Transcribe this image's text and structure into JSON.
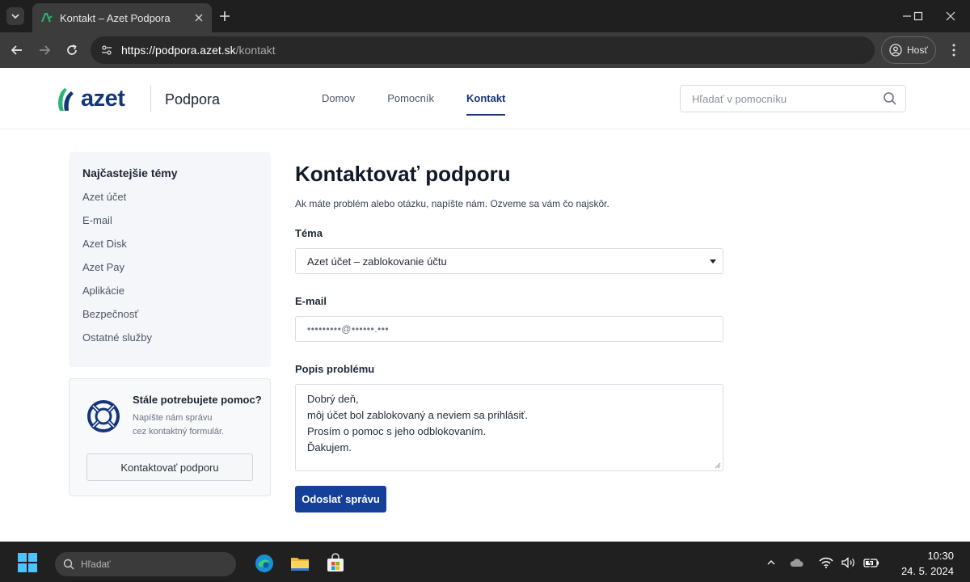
{
  "browser": {
    "tab_title": "Kontakt – Azet Podpora",
    "url_host": "https://podpora.azet.sk",
    "url_path": "/kontakt",
    "profile_label": "Hosť"
  },
  "site": {
    "logo_text": "azet",
    "site_name": "Podpora",
    "nav": [
      {
        "label": "Domov",
        "active": false
      },
      {
        "label": "Pomocník",
        "active": false
      },
      {
        "label": "Kontakt",
        "active": true
      }
    ],
    "search_placeholder": "Hľadať v pomocníku"
  },
  "sidebar": {
    "title": "Najčastejšie témy",
    "items": [
      "Azet účet",
      "E-mail",
      "Azet Disk",
      "Azet Pay",
      "Aplikácie",
      "Bezpečnosť",
      "Ostatné služby"
    ],
    "help": {
      "title": "Stále potrebujete pomoc?",
      "text_line1": "Napíšte nám správu",
      "text_line2": "cez kontaktný formulár.",
      "button": "Kontaktovať podporu"
    }
  },
  "form": {
    "heading": "Kontaktovať podporu",
    "intro": "Ak máte problém alebo otázku, napíšte nám. Ozveme sa vám čo najskôr.",
    "topic_label": "Téma",
    "topic_value": "Azet účet – zablokovanie účtu",
    "email_label": "E-mail",
    "email_value": "•••••••••@••••••.•••",
    "description_label": "Popis problému",
    "description_lines": [
      "Dobrý deň,",
      "môj účet bol zablokovaný a neviem sa prihlásiť.",
      "Prosím o pomoc s jeho odblokovaním.",
      "Ďakujem."
    ],
    "submit": "Odoslať správu"
  },
  "taskbar": {
    "search_placeholder": "Hľadať",
    "time": "10:30",
    "date": "24. 5. 2024"
  },
  "colors": {
    "brand_blue": "#14357a",
    "brand_green": "#2bb673",
    "button_blue": "#14409a"
  }
}
